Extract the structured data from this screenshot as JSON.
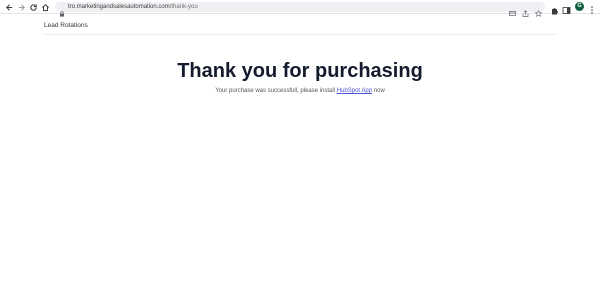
{
  "browser": {
    "url_host": "tro.marketingandsalesautomation.com",
    "url_path": "/thank-you",
    "avatar_initial": "G",
    "icons": [
      "back-icon",
      "forward-icon",
      "reload-icon",
      "home-icon",
      "lock-icon",
      "card-icon",
      "share-icon",
      "bookmark-star-icon",
      "extensions-icon",
      "sidepanel-icon",
      "menu-icon"
    ]
  },
  "site": {
    "brand": "Lead Rotations"
  },
  "hero": {
    "title": "Thank you for purchasing",
    "subtitle_before": "Your purchase was successfull, please install",
    "link_text": "HubSpot App",
    "subtitle_after": "now"
  },
  "colors": {
    "title": "#141b2c",
    "link": "#4a54d6",
    "avatar_bg": "#0f5f3f"
  }
}
